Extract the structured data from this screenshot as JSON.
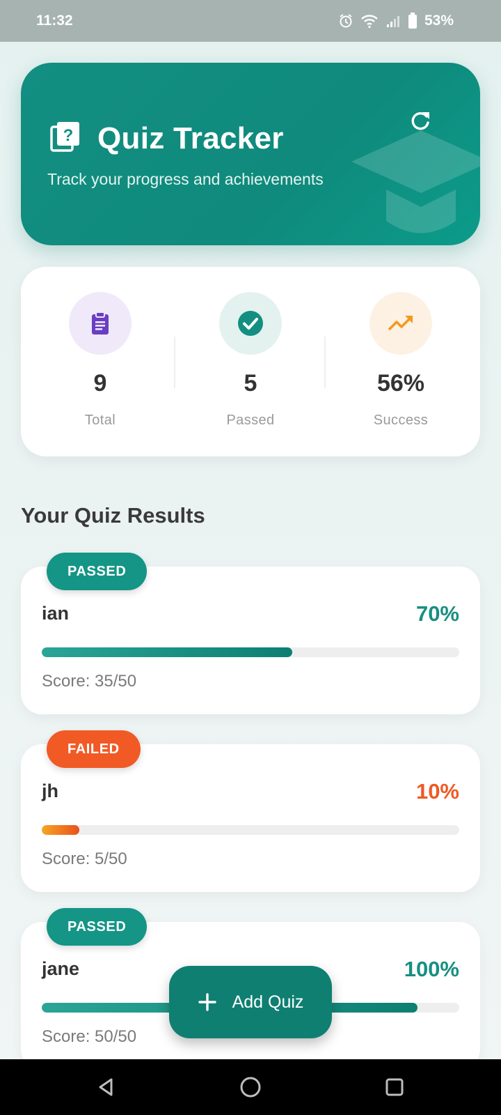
{
  "status_bar": {
    "time": "11:32",
    "battery": "53%",
    "icons": [
      "alarm-icon",
      "wifi-icon",
      "signal-icon",
      "battery-icon"
    ]
  },
  "header": {
    "title": "Quiz Tracker",
    "subtitle": "Track your progress and achievements",
    "icon": "quiz-icon",
    "refresh_icon": "refresh-icon",
    "decoration_icon": "graduation-cap-icon"
  },
  "stats": [
    {
      "value": "9",
      "label": "Total",
      "icon": "clipboard-icon",
      "color": "#6a3fc1",
      "bg": "#efe9fa"
    },
    {
      "value": "5",
      "label": "Passed",
      "icon": "check-circle-icon",
      "color": "#138f81",
      "bg": "#e3f2ef"
    },
    {
      "value": "56%",
      "label": "Success",
      "icon": "trending-up-icon",
      "color": "#f29a1f",
      "bg": "#fdf1e3"
    }
  ],
  "section_title": "Your Quiz Results",
  "quizzes": [
    {
      "status": "PASSED",
      "name": "ian",
      "percent": "70%",
      "progress": 0.6,
      "score": "Score: 35/50"
    },
    {
      "status": "FAILED",
      "name": "jh",
      "percent": "10%",
      "progress": 0.09,
      "score": "Score: 5/50"
    },
    {
      "status": "PASSED",
      "name": "jane",
      "percent": "100%",
      "progress": 0.9,
      "score": "Score: 50/50"
    }
  ],
  "fab": {
    "label": "Add Quiz",
    "icon": "plus-icon"
  },
  "nav": {
    "icons": [
      "back-icon",
      "home-icon",
      "recents-icon"
    ]
  },
  "colors": {
    "primary": "#138f81",
    "fail": "#ee5a24",
    "accent_warn": "#f29a1f"
  }
}
